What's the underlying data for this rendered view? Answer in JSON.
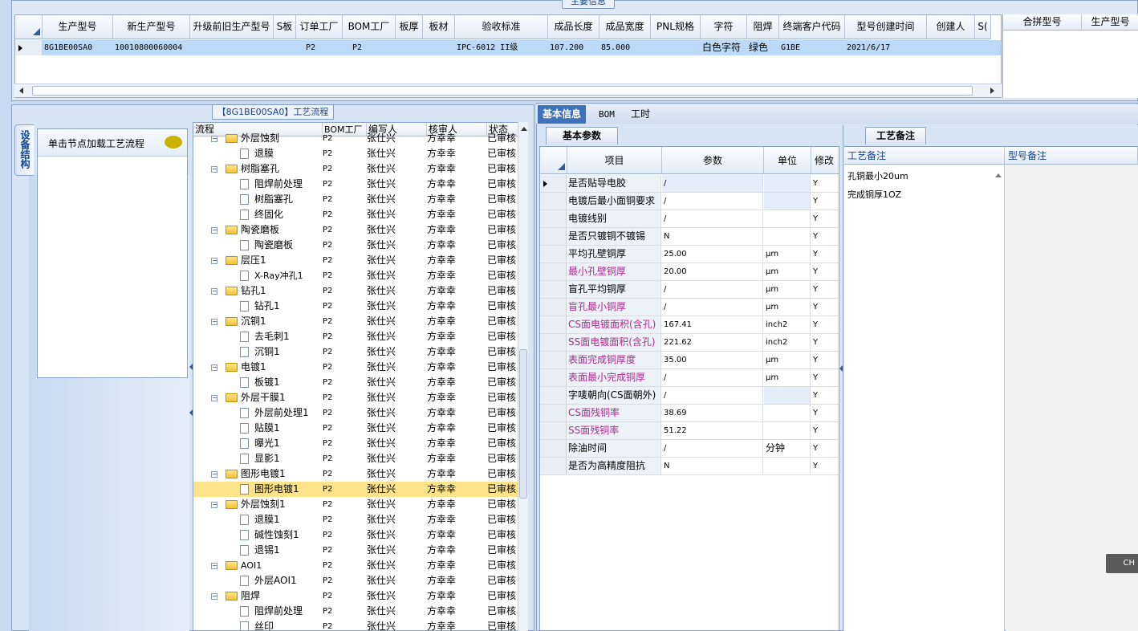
{
  "top": {
    "section_title": "主要信息",
    "headers": [
      "生产型号",
      "新生产型号",
      "升级前旧生产型号",
      "S板",
      "订单工厂",
      "BOM工厂",
      "板厚",
      "板材",
      "验收标准",
      "成品长度",
      "成品宽度",
      "PNL规格",
      "字符",
      "阻焊",
      "终端客户代码",
      "型号创建时间",
      "创建人",
      "S("
    ],
    "row": {
      "c0": "8G1BE00SA0",
      "c1": "10010800060004",
      "c4": "P2",
      "c5": "P2",
      "c8": "IPC-6012 II级",
      "c9": "107.200",
      "c10": "85.000",
      "c12": "白色字符",
      "c13": "绿色",
      "c14": "G1BE",
      "c15": "2021/6/17"
    },
    "merge_headers": [
      "合拼型号",
      "生产型号"
    ]
  },
  "flow": {
    "title": "【8G1BE00SA0】工艺流程",
    "side_tab": "设备结构",
    "node_hint": "单击节点加载工艺流程",
    "headers": [
      "流程",
      "BOM工厂",
      "编写人",
      "核审人",
      "状态"
    ],
    "rows": [
      {
        "name": "外层蚀刻",
        "type": "folder",
        "bom": "P2",
        "writer": "张仕兴",
        "reviewer": "方幸幸",
        "status": "已审核"
      },
      {
        "name": "退膜",
        "type": "doc",
        "bom": "P2",
        "writer": "张仕兴",
        "reviewer": "方幸幸",
        "status": "已审核"
      },
      {
        "name": "树脂塞孔",
        "type": "folder",
        "bom": "P2",
        "writer": "张仕兴",
        "reviewer": "方幸幸",
        "status": "已审核"
      },
      {
        "name": "阻焊前处理",
        "type": "doc",
        "bom": "P2",
        "writer": "张仕兴",
        "reviewer": "方幸幸",
        "status": "已审核"
      },
      {
        "name": "树脂塞孔",
        "type": "doc",
        "bom": "P2",
        "writer": "张仕兴",
        "reviewer": "方幸幸",
        "status": "已审核"
      },
      {
        "name": "终固化",
        "type": "doc",
        "bom": "P2",
        "writer": "张仕兴",
        "reviewer": "方幸幸",
        "status": "已审核"
      },
      {
        "name": "陶瓷磨板",
        "type": "folder",
        "bom": "P2",
        "writer": "张仕兴",
        "reviewer": "方幸幸",
        "status": "已审核"
      },
      {
        "name": "陶瓷磨板",
        "type": "doc",
        "bom": "P2",
        "writer": "张仕兴",
        "reviewer": "方幸幸",
        "status": "已审核"
      },
      {
        "name": "层压1",
        "type": "folder",
        "bom": "P2",
        "writer": "张仕兴",
        "reviewer": "方幸幸",
        "status": "已审核"
      },
      {
        "name": "X-Ray冲孔1",
        "type": "doc",
        "bom": "P2",
        "writer": "张仕兴",
        "reviewer": "方幸幸",
        "status": "已审核"
      },
      {
        "name": "钻孔1",
        "type": "folder",
        "bom": "P2",
        "writer": "张仕兴",
        "reviewer": "方幸幸",
        "status": "已审核"
      },
      {
        "name": "钻孔1",
        "type": "doc",
        "bom": "P2",
        "writer": "张仕兴",
        "reviewer": "方幸幸",
        "status": "已审核"
      },
      {
        "name": "沉铜1",
        "type": "folder",
        "bom": "P2",
        "writer": "张仕兴",
        "reviewer": "方幸幸",
        "status": "已审核"
      },
      {
        "name": "去毛刺1",
        "type": "doc",
        "bom": "P2",
        "writer": "张仕兴",
        "reviewer": "方幸幸",
        "status": "已审核"
      },
      {
        "name": "沉铜1",
        "type": "doc",
        "bom": "P2",
        "writer": "张仕兴",
        "reviewer": "方幸幸",
        "status": "已审核"
      },
      {
        "name": "电镀1",
        "type": "folder",
        "bom": "P2",
        "writer": "张仕兴",
        "reviewer": "方幸幸",
        "status": "已审核"
      },
      {
        "name": "板镀1",
        "type": "doc",
        "bom": "P2",
        "writer": "张仕兴",
        "reviewer": "方幸幸",
        "status": "已审核"
      },
      {
        "name": "外层干膜1",
        "type": "folder",
        "bom": "P2",
        "writer": "张仕兴",
        "reviewer": "方幸幸",
        "status": "已审核"
      },
      {
        "name": "外层前处理1",
        "type": "doc",
        "bom": "P2",
        "writer": "张仕兴",
        "reviewer": "方幸幸",
        "status": "已审核"
      },
      {
        "name": "贴膜1",
        "type": "doc",
        "bom": "P2",
        "writer": "张仕兴",
        "reviewer": "方幸幸",
        "status": "已审核"
      },
      {
        "name": "曝光1",
        "type": "doc",
        "bom": "P2",
        "writer": "张仕兴",
        "reviewer": "方幸幸",
        "status": "已审核"
      },
      {
        "name": "显影1",
        "type": "doc",
        "bom": "P2",
        "writer": "张仕兴",
        "reviewer": "方幸幸",
        "status": "已审核"
      },
      {
        "name": "图形电镀1",
        "type": "folder",
        "bom": "P2",
        "writer": "张仕兴",
        "reviewer": "方幸幸",
        "status": "已审核"
      },
      {
        "name": "图形电镀1",
        "type": "doc",
        "bom": "P2",
        "writer": "张仕兴",
        "reviewer": "方幸幸",
        "status": "已审核",
        "selected": true
      },
      {
        "name": "外层蚀刻1",
        "type": "folder",
        "bom": "P2",
        "writer": "张仕兴",
        "reviewer": "方幸幸",
        "status": "已审核"
      },
      {
        "name": "退膜1",
        "type": "doc",
        "bom": "P2",
        "writer": "张仕兴",
        "reviewer": "方幸幸",
        "status": "已审核"
      },
      {
        "name": "碱性蚀刻1",
        "type": "doc",
        "bom": "P2",
        "writer": "张仕兴",
        "reviewer": "方幸幸",
        "status": "已审核"
      },
      {
        "name": "退锡1",
        "type": "doc",
        "bom": "P2",
        "writer": "张仕兴",
        "reviewer": "方幸幸",
        "status": "已审核"
      },
      {
        "name": "AOI1",
        "type": "folder",
        "bom": "P2",
        "writer": "张仕兴",
        "reviewer": "方幸幸",
        "status": "已审核"
      },
      {
        "name": "外层AOI1",
        "type": "doc",
        "bom": "P2",
        "writer": "张仕兴",
        "reviewer": "方幸幸",
        "status": "已审核"
      },
      {
        "name": "阻焊",
        "type": "folder",
        "bom": "P2",
        "writer": "张仕兴",
        "reviewer": "方幸幸",
        "status": "已审核"
      },
      {
        "name": "阻焊前处理",
        "type": "doc",
        "bom": "P2",
        "writer": "张仕兴",
        "reviewer": "方幸幸",
        "status": "已审核"
      },
      {
        "name": "丝印",
        "type": "doc",
        "bom": "P2",
        "writer": "张仕兴",
        "reviewer": "方幸幸",
        "status": "已审核"
      }
    ]
  },
  "detail": {
    "tabs": [
      "基本信息",
      "BOM",
      "工时"
    ],
    "sub_tab": "基本参数",
    "headers": [
      "项目",
      "参数",
      "单位",
      "修改"
    ],
    "rows": [
      {
        "item": "是否贴导电胶",
        "value": "/",
        "unit": "",
        "mod": "Y",
        "pink": false
      },
      {
        "item": "电镀后最小面铜要求",
        "value": "/",
        "unit": "",
        "mod": "Y",
        "pink": false
      },
      {
        "item": "电镀线别",
        "value": "/",
        "unit": "",
        "mod": "Y",
        "pink": false
      },
      {
        "item": "是否只镀铜不镀锡",
        "value": "N",
        "unit": "",
        "mod": "Y",
        "pink": false
      },
      {
        "item": "平均孔壁铜厚",
        "value": "25.00",
        "unit": "μm",
        "mod": "Y",
        "pink": false
      },
      {
        "item": "最小孔壁铜厚",
        "value": "20.00",
        "unit": "μm",
        "mod": "Y",
        "pink": true
      },
      {
        "item": "盲孔平均铜厚",
        "value": "/",
        "unit": "μm",
        "mod": "Y",
        "pink": false
      },
      {
        "item": "盲孔最小铜厚",
        "value": "/",
        "unit": "μm",
        "mod": "Y",
        "pink": true
      },
      {
        "item": "CS面电镀面积(含孔)",
        "value": "167.41",
        "unit": "inch2",
        "mod": "Y",
        "pink": true
      },
      {
        "item": "SS面电镀面积(含孔)",
        "value": "221.62",
        "unit": "inch2",
        "mod": "Y",
        "pink": true
      },
      {
        "item": "表面完成铜厚度",
        "value": "35.00",
        "unit": "μm",
        "mod": "Y",
        "pink": true
      },
      {
        "item": "表面最小完成铜厚",
        "value": "/",
        "unit": "μm",
        "mod": "Y",
        "pink": true
      },
      {
        "item": "字唛朝向(CS面朝外)",
        "value": "/",
        "unit": "",
        "mod": "Y",
        "pink": false
      },
      {
        "item": "CS面残铜率",
        "value": "38.69",
        "unit": "",
        "mod": "Y",
        "pink": true
      },
      {
        "item": "SS面残铜率",
        "value": "51.22",
        "unit": "",
        "mod": "Y",
        "pink": true
      },
      {
        "item": "除油时间",
        "value": "/",
        "unit": "分钟",
        "mod": "Y",
        "pink": false
      },
      {
        "item": "是否为高精度阻抗",
        "value": "N",
        "unit": "",
        "mod": "Y",
        "pink": false
      }
    ]
  },
  "notes": {
    "tab": "工艺备注",
    "headers": [
      "工艺备注",
      "型号备注"
    ],
    "lines": [
      "孔铜最小20um",
      "完成铜厚1OZ"
    ]
  },
  "ime_badge": "CH",
  "colors": {
    "selected_row": "#fde38a",
    "accent": "#3e73b9",
    "pink_text": "#b0278f"
  }
}
